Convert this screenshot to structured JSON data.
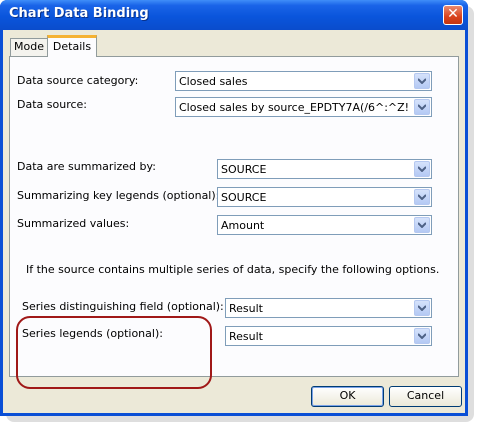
{
  "window": {
    "title": "Chart Data Binding"
  },
  "tabs": [
    {
      "label": "Mode"
    },
    {
      "label": "Details"
    }
  ],
  "fields": [
    {
      "label": "Data source category:",
      "value": "Closed sales"
    },
    {
      "label": "Data source:",
      "value": "Closed sales by source_EPDTY7A(/6^:^Z!"
    },
    {
      "label": "Data are summarized by:",
      "value": "SOURCE"
    },
    {
      "label": "Summarizing key legends (optional):",
      "value": "SOURCE"
    },
    {
      "label": "Summarized values:",
      "value": "Amount"
    },
    {
      "label": "Series distinguishing field (optional):",
      "value": "Result"
    },
    {
      "label": "Series legends (optional):",
      "value": "Result"
    }
  ],
  "note": "If the source contains multiple series of data, specify the following options.",
  "buttons": {
    "ok": "OK",
    "cancel": "Cancel"
  },
  "colors": {
    "title_bar": "#0a55dc",
    "highlight": "#a01818",
    "dialog_bg": "#ece9d8"
  },
  "icons": {
    "close": "close-icon",
    "dropdown": "chevron-down-icon"
  }
}
